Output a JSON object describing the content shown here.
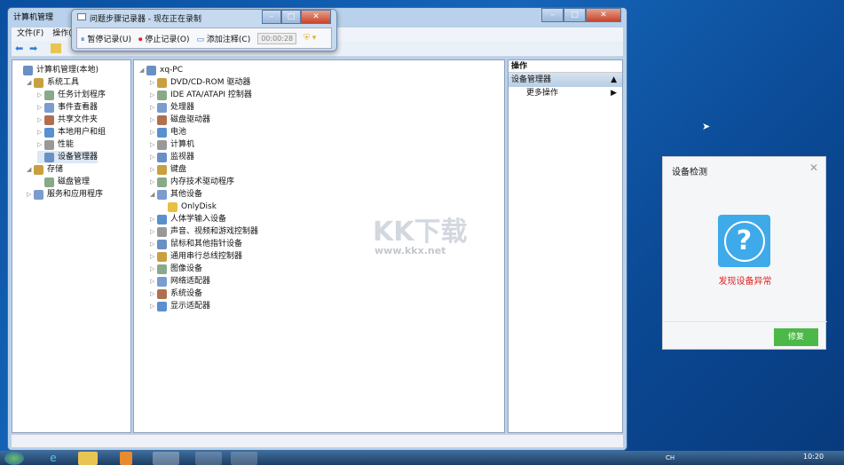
{
  "main_window": {
    "title": "计算机管理",
    "menu": [
      "文件(F)",
      "操作(A)"
    ]
  },
  "recorder": {
    "title": "问题步骤记录器 - 现在正在录制",
    "pause": "暂停记录(U)",
    "stop": "停止记录(O)",
    "comment": "添加注释(C)",
    "timer": "00:00:28"
  },
  "left_tree": [
    {
      "label": "计算机管理(本地)",
      "level": 0,
      "exp": ""
    },
    {
      "label": "系统工具",
      "level": 1,
      "exp": "◢"
    },
    {
      "label": "任务计划程序",
      "level": 2,
      "exp": "▷"
    },
    {
      "label": "事件查看器",
      "level": 2,
      "exp": "▷"
    },
    {
      "label": "共享文件夹",
      "level": 2,
      "exp": "▷"
    },
    {
      "label": "本地用户和组",
      "level": 2,
      "exp": "▷"
    },
    {
      "label": "性能",
      "level": 2,
      "exp": "▷"
    },
    {
      "label": "设备管理器",
      "level": 2,
      "exp": ""
    },
    {
      "label": "存储",
      "level": 1,
      "exp": "◢"
    },
    {
      "label": "磁盘管理",
      "level": 2,
      "exp": ""
    },
    {
      "label": "服务和应用程序",
      "level": 1,
      "exp": "▷"
    }
  ],
  "device_tree": [
    {
      "label": "xq-PC",
      "level": 0,
      "exp": "◢"
    },
    {
      "label": "DVD/CD-ROM 驱动器",
      "level": 1,
      "exp": "▷"
    },
    {
      "label": "IDE ATA/ATAPI 控制器",
      "level": 1,
      "exp": "▷"
    },
    {
      "label": "处理器",
      "level": 1,
      "exp": "▷"
    },
    {
      "label": "磁盘驱动器",
      "level": 1,
      "exp": "▷"
    },
    {
      "label": "电池",
      "level": 1,
      "exp": "▷"
    },
    {
      "label": "计算机",
      "level": 1,
      "exp": "▷"
    },
    {
      "label": "监视器",
      "level": 1,
      "exp": "▷"
    },
    {
      "label": "键盘",
      "level": 1,
      "exp": "▷"
    },
    {
      "label": "内存技术驱动程序",
      "level": 1,
      "exp": "▷"
    },
    {
      "label": "其他设备",
      "level": 1,
      "exp": "◢"
    },
    {
      "label": "OnlyDisk",
      "level": 2,
      "exp": ""
    },
    {
      "label": "人体学输入设备",
      "level": 1,
      "exp": "▷"
    },
    {
      "label": "声音、视频和游戏控制器",
      "level": 1,
      "exp": "▷"
    },
    {
      "label": "鼠标和其他指针设备",
      "level": 1,
      "exp": "▷"
    },
    {
      "label": "通用串行总线控制器",
      "level": 1,
      "exp": "▷"
    },
    {
      "label": "图像设备",
      "level": 1,
      "exp": "▷"
    },
    {
      "label": "网络适配器",
      "level": 1,
      "exp": "▷"
    },
    {
      "label": "系统设备",
      "level": 1,
      "exp": "▷"
    },
    {
      "label": "显示适配器",
      "level": 1,
      "exp": "▷"
    }
  ],
  "actions": {
    "header": "操作",
    "section": "设备管理器",
    "more": "更多操作"
  },
  "dialog": {
    "title": "设备检测",
    "message": "发现设备异常",
    "button": "修复",
    "accent": "#4cb848",
    "icon_color": "#3eaaea",
    "message_color": "#e02020"
  },
  "watermark": {
    "brand": "KK下载",
    "url": "www.kkx.net"
  },
  "taskbar": {
    "lang": "CH",
    "time": "10:20"
  }
}
